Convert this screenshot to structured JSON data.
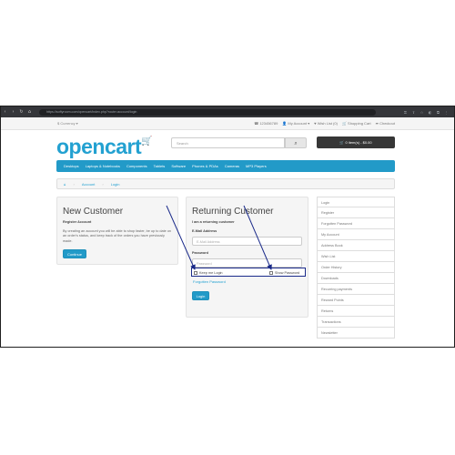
{
  "browser": {
    "url": "https://softyroom.com/opencart/index.php?route=account/login",
    "nav_icons": [
      "back-icon",
      "forward-icon",
      "reload-icon",
      "home-icon"
    ],
    "extension_icons": [
      "key-icon",
      "share-icon",
      "star-icon",
      "extension-icon",
      "puzzle-icon",
      "menu-icon"
    ]
  },
  "topbar": {
    "currency": "$ Currency ▾",
    "links": [
      "☎ 123456789",
      "👤 My Account ▾",
      "♥ Wish List (0)",
      "🛒 Shopping Cart",
      "➦ Checkout"
    ]
  },
  "header": {
    "logo": "opencart",
    "search_placeholder": "Search",
    "cart_label": "🛒 0 item(s) - $0.00"
  },
  "menu": {
    "items": [
      "Desktops",
      "Laptops & Notebooks",
      "Components",
      "Tablets",
      "Software",
      "Phones & PDAs",
      "Cameras",
      "MP3 Players"
    ]
  },
  "breadcrumb": {
    "home_icon": "home-icon",
    "items": [
      "Account",
      "Login"
    ]
  },
  "new_customer": {
    "title": "New Customer",
    "subtitle": "Register Account",
    "text": "By creating an account you will be able to shop faster, be up to date on an order's status, and keep track of the orders you have previously made.",
    "button": "Continue"
  },
  "returning_customer": {
    "title": "Returning Customer",
    "subtitle": "I am a returning customer",
    "email_label": "E-Mail Address",
    "email_placeholder": "E-Mail Address",
    "password_label": "Password",
    "password_placeholder": "Password",
    "keep_login": "Keep me Login",
    "show_password": "Show Password",
    "forgot": "Forgotten Password",
    "button": "Login"
  },
  "sidebar": {
    "items": [
      "Login",
      "Register",
      "Forgotten Password",
      "My Account",
      "Address Book",
      "Wish List",
      "Order History",
      "Downloads",
      "Recurring payments",
      "Reward Points",
      "Returns",
      "Transactions",
      "Newsletter"
    ]
  },
  "colors": {
    "accent": "#229ac8",
    "annotation": "#1a2a8a"
  }
}
